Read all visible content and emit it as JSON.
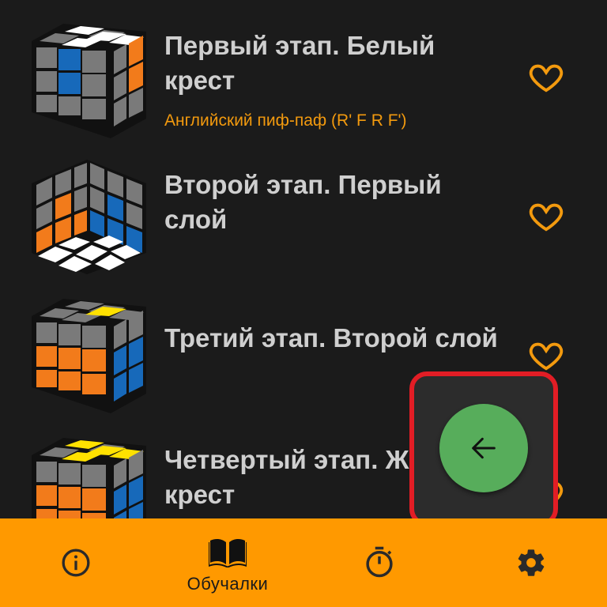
{
  "stages": [
    {
      "title_line1": "Первый этап. Белый",
      "title_line2": "крест",
      "subtitle": "Английский пиф-паф (R' F R F')"
    },
    {
      "title_line1": "Второй этап. Первый",
      "title_line2": "слой"
    },
    {
      "title_line1": "Третий этап. Второй слой"
    },
    {
      "title_line1": "Четвертый этап. Жел",
      "title_line2": "крест"
    }
  ],
  "favorite_icon": "heart-outline-icon",
  "fab": {
    "icon": "arrow-left-icon",
    "color": "#57ad5b"
  },
  "highlight_color": "#e21d25",
  "bottom_nav": {
    "background": "#ff9900",
    "items": [
      {
        "icon": "info-icon",
        "label": ""
      },
      {
        "icon": "book-icon",
        "label": "Обучалки",
        "active": true
      },
      {
        "icon": "stopwatch-icon",
        "label": ""
      },
      {
        "icon": "gear-icon",
        "label": ""
      }
    ]
  }
}
